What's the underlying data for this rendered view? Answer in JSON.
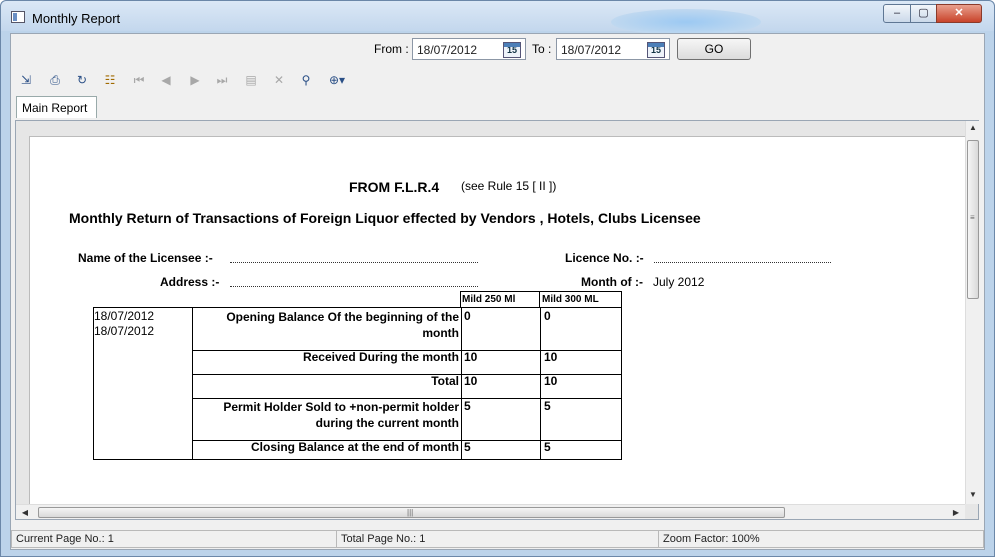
{
  "window": {
    "title": "Monthly Report",
    "min_glyph": "–",
    "max_glyph": "▢",
    "close_glyph": "✕"
  },
  "filter": {
    "from_label": "From :",
    "from_value": "18/07/2012",
    "to_label": "To :",
    "to_value": "18/07/2012",
    "calendar_day": "15",
    "go_label": "GO"
  },
  "toolbar": {
    "icons": [
      "export-icon",
      "print-icon",
      "refresh-icon",
      "group-tree-icon",
      "first-page-icon",
      "previous-page-icon",
      "next-page-icon",
      "last-page-icon",
      "goto-page-icon",
      "close-view-icon",
      "find-icon",
      "zoom-icon"
    ]
  },
  "tabs": [
    {
      "label": "Main Report"
    }
  ],
  "report": {
    "form_title": "FROM F.L.R.4",
    "form_rule": "(see Rule 15 [ II ])",
    "heading": "Monthly Return of Transactions of Foreign Liquor effected by Vendors , Hotels, Clubs Licensee",
    "licensee_label": "Name of the Licensee :-",
    "address_label": "Address :-",
    "licence_label": "Licence No. :-",
    "month_label": "Month of :-",
    "month_value": "July 2012",
    "col_headers": [
      "Mild 250 Ml",
      "Mild 300 ML"
    ],
    "dates": [
      "18/07/2012",
      "18/07/2012"
    ],
    "rows": [
      {
        "label": "Opening Balance Of the beginning of the month",
        "v1": "0",
        "v2": "0"
      },
      {
        "label": "Received During the month",
        "v1": "10",
        "v2": "10"
      },
      {
        "label": "Total",
        "v1": "10",
        "v2": "10"
      },
      {
        "label": "Permit Holder Sold to +non-permit holder during the current month",
        "v1": "5",
        "v2": "5"
      },
      {
        "label": "Closing Balance at the end of month",
        "v1": "5",
        "v2": "5"
      }
    ]
  },
  "status": {
    "current_page": "Current Page No.: 1",
    "total_page": "Total Page No.: 1",
    "zoom": "Zoom Factor: 100%"
  }
}
